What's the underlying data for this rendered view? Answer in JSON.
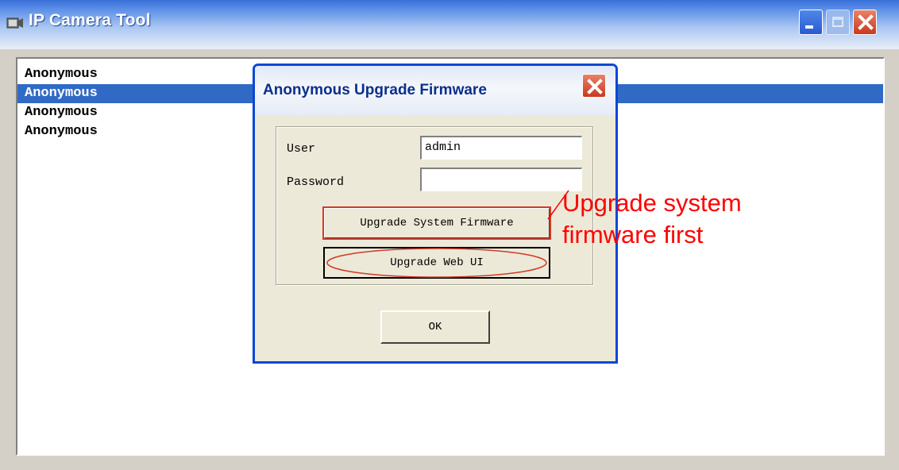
{
  "window": {
    "title": "IP Camera Tool",
    "app_icon": "camera-app-icon"
  },
  "list": {
    "items": [
      {
        "label": "Anonymous",
        "selected": false
      },
      {
        "label": "Anonymous",
        "selected": true
      },
      {
        "label": "Anonymous",
        "selected": false
      },
      {
        "label": "Anonymous",
        "selected": false
      }
    ]
  },
  "dialog": {
    "title": "Anonymous Upgrade Firmware",
    "user_label": "User",
    "user_value": "admin",
    "password_label": "Password",
    "password_value": "",
    "upgrade_system_label": "Upgrade System Firmware",
    "upgrade_web_label": "Upgrade Web UI",
    "ok_label": "OK"
  },
  "annotation": {
    "line1": "Upgrade system",
    "line2": "firmware first",
    "color": "#ff0000"
  },
  "colors": {
    "selection": "#316ac5",
    "dialog_border": "#0a46d8",
    "dialog_title_text": "#0a2f8c"
  }
}
